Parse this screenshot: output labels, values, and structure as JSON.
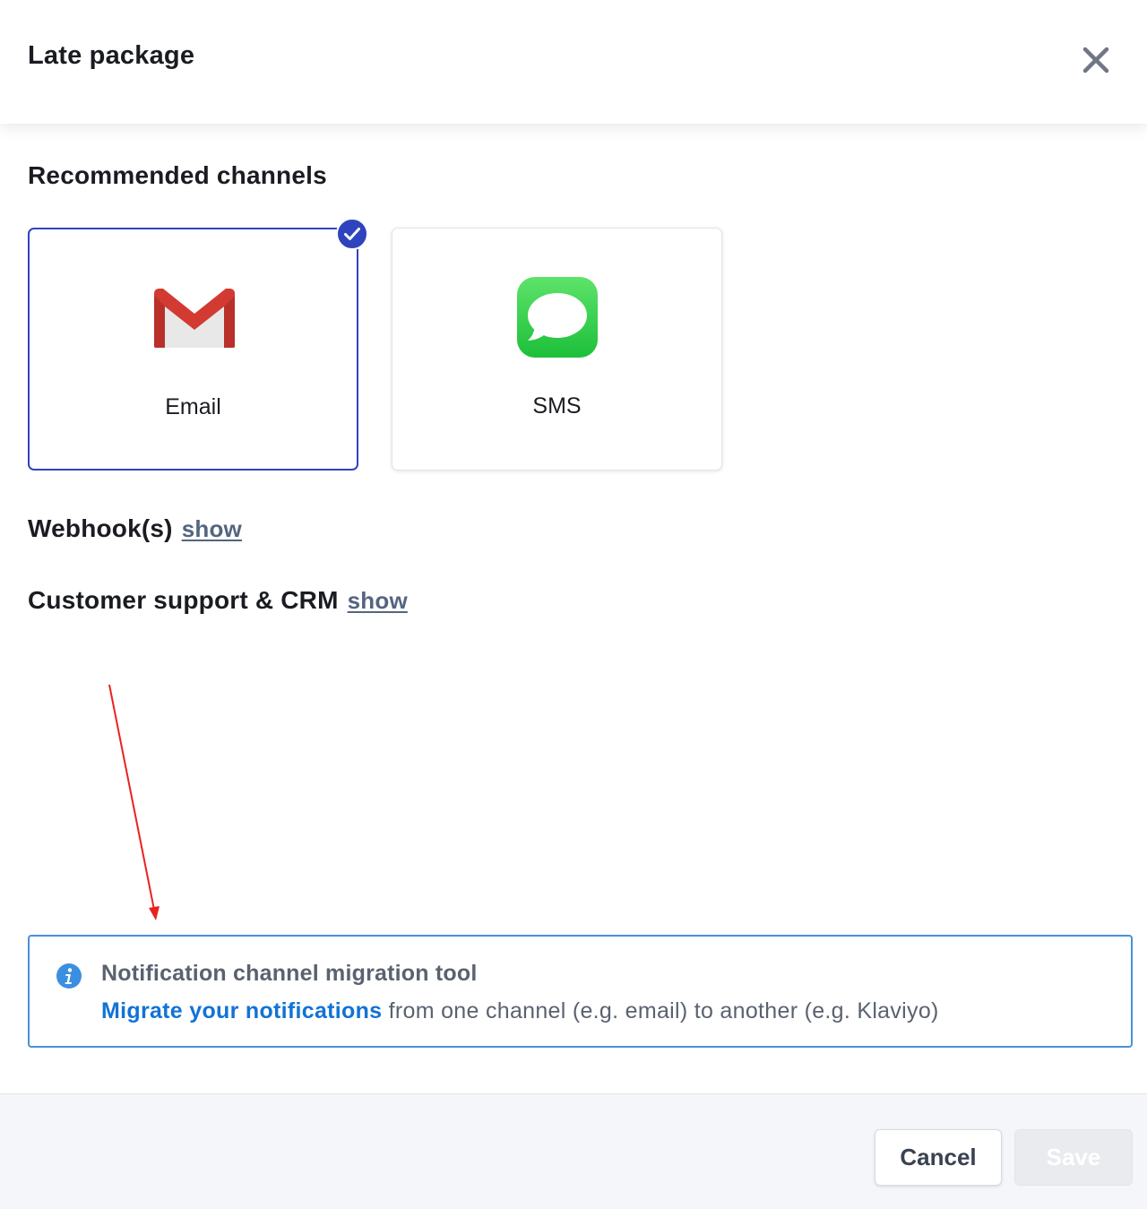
{
  "header": {
    "title": "Late package",
    "close_icon": "close-icon"
  },
  "recommended": {
    "title": "Recommended channels",
    "channels": [
      {
        "label": "Email",
        "icon": "gmail-icon",
        "selected": true
      },
      {
        "label": "SMS",
        "icon": "messages-icon",
        "selected": false
      }
    ]
  },
  "webhooks": {
    "title": "Webhook(s)",
    "link": "show"
  },
  "crm": {
    "title": "Customer support & CRM",
    "link": "show"
  },
  "callout": {
    "icon": "info-icon",
    "title": "Notification channel migration tool",
    "link": "Migrate your notifications",
    "text": " from one channel (e.g. email) to another (e.g. Klaviyo)"
  },
  "footer": {
    "cancel_label": "Cancel",
    "save_label": "Save"
  },
  "colors": {
    "selected_border": "#3043bf",
    "link_blue": "#1173d4",
    "callout_border": "#4a90d9",
    "annotation_arrow": "#e8231f"
  }
}
